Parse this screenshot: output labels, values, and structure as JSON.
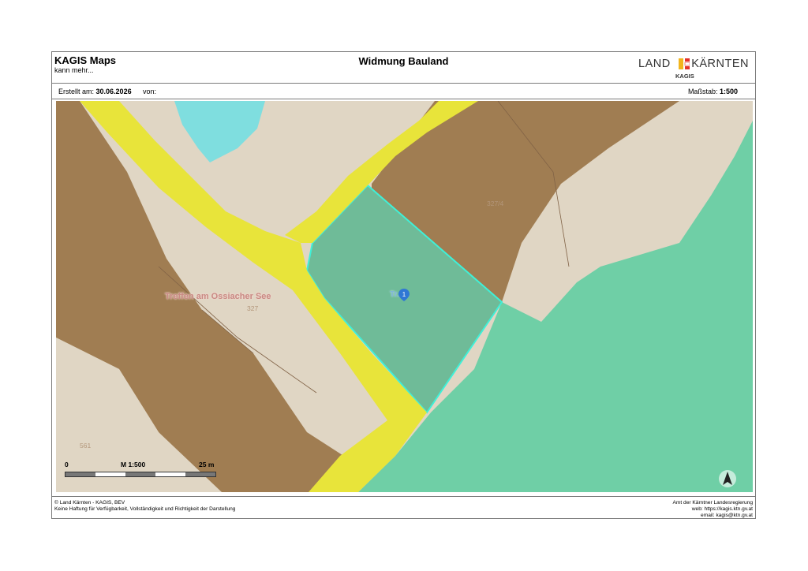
{
  "header": {
    "app_title": "KAGIS Maps",
    "app_subtitle": "kann mehr...",
    "doc_title": "Widmung Bauland",
    "logo_left": "LAND",
    "logo_right": "KÄRNTEN",
    "logo_sub": "KAGIS"
  },
  "info": {
    "created_label": "Erstellt am:",
    "created_value": "30.06.2026",
    "from_label": "von:",
    "scale_label": "Maßstab:",
    "scale_value": "1:500"
  },
  "map": {
    "place_label": "Treffen am Ossiacher See",
    "parcels": [
      "327",
      "327/4",
      "561"
    ],
    "marker_number": "1",
    "marker_label": "Tr. fn",
    "colors": {
      "bauland": "#a07d52",
      "verkehr": "#e8e43a",
      "gruen": "#6fcfa6",
      "gewaesser": "#7fdedf",
      "unbebaut": "#e0d6c4",
      "selection": "#3ff0d8"
    }
  },
  "scalebar": {
    "start": "0",
    "mid": "M 1:500",
    "end": "25 m"
  },
  "north_icon": "north-arrow-icon",
  "footer": {
    "left_1": "© Land Kärnten - KAGIS, BEV",
    "left_2": "Keine Haftung für Verfügbarkeit, Vollständigkeit und Richtigkeit der Darstellung",
    "right_1": "Amt der Kärntner Landesregierung",
    "right_2": "web: https://kagis.ktn.gv.at",
    "right_3": "email: kagis@ktn.gv.at"
  }
}
